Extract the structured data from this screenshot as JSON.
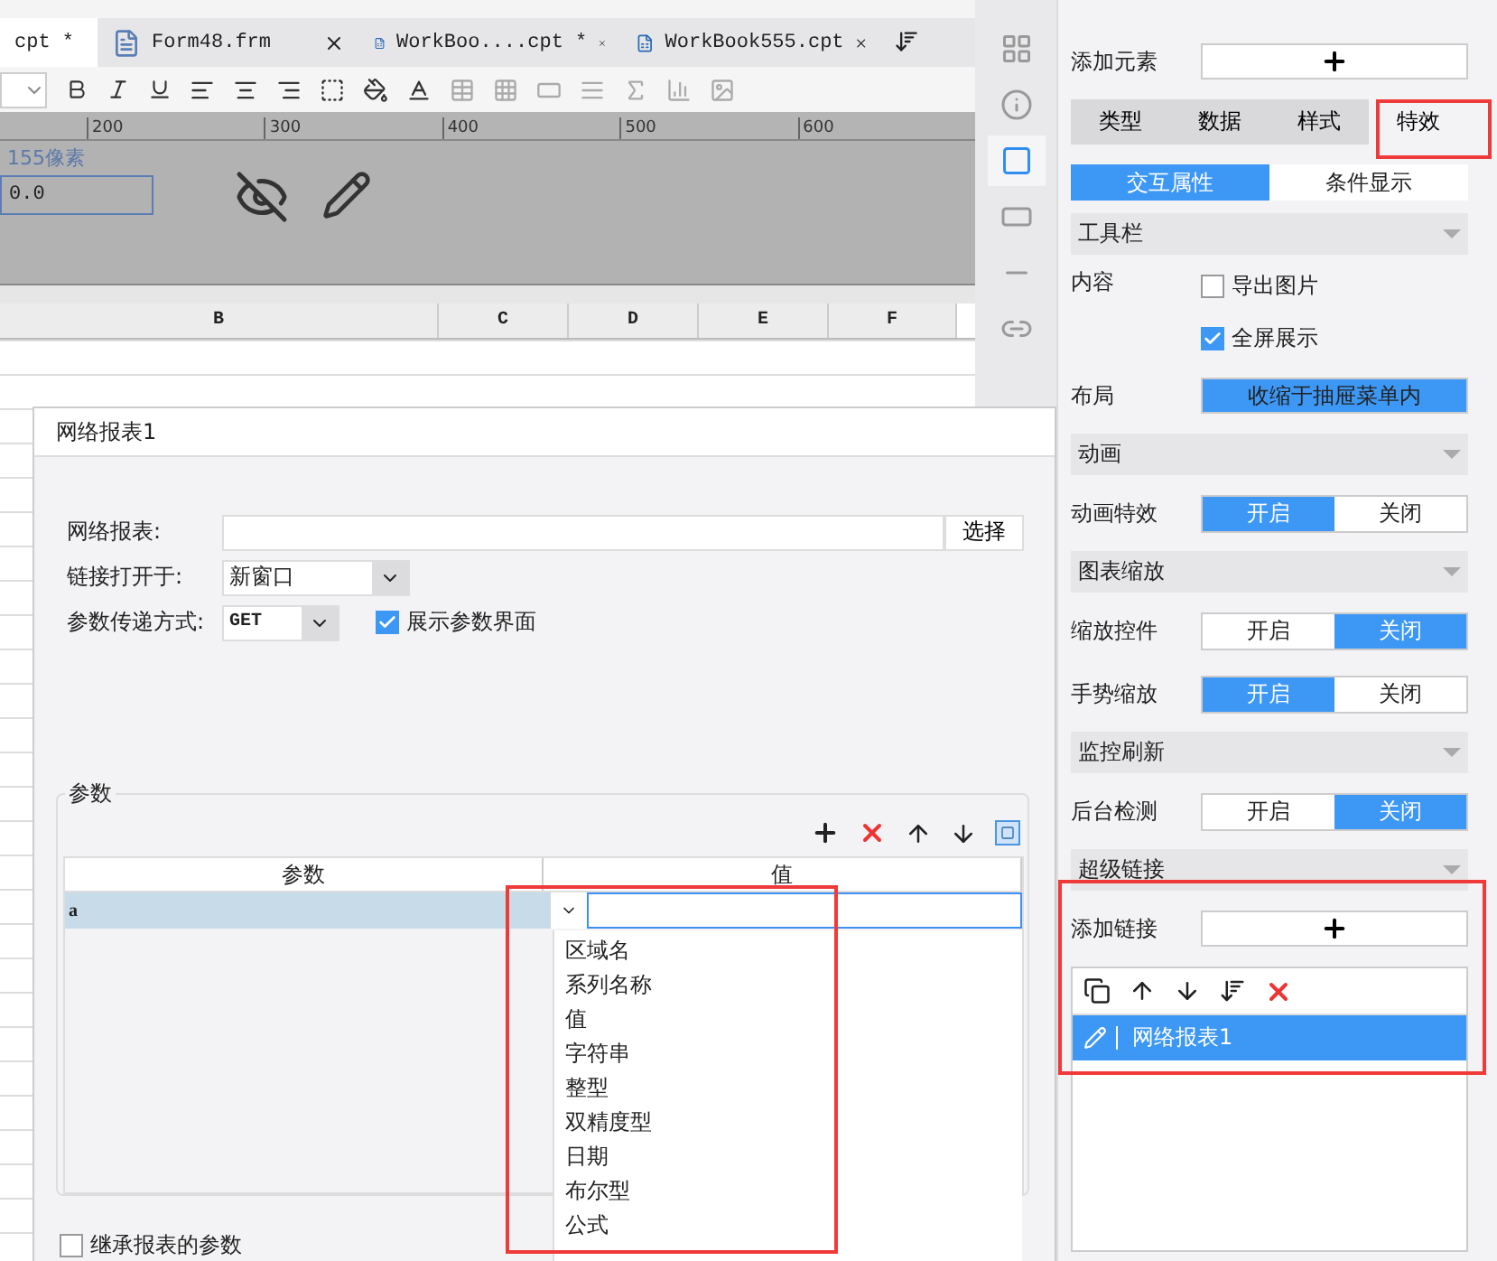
{
  "editor_tabs": [
    {
      "label": "cpt *",
      "selected": true
    },
    {
      "label": "Form48.frm",
      "kind": "form",
      "selected": false
    },
    {
      "label": "WorkBoo....cpt *",
      "kind": "report",
      "selected": false
    },
    {
      "label": "WorkBook555.cpt",
      "kind": "report",
      "selected": false
    }
  ],
  "ruler": [
    "200",
    "300",
    "400",
    "500",
    "600"
  ],
  "canvas": {
    "size_label": "155像素",
    "field_value": "0.0"
  },
  "sheet_columns": [
    "B",
    "C",
    "D",
    "E",
    "F"
  ],
  "right_panel": {
    "add_element_label": "添加元素",
    "tabs": [
      {
        "label": "类型",
        "selected": false
      },
      {
        "label": "数据",
        "selected": false
      },
      {
        "label": "样式",
        "selected": false
      },
      {
        "label": "特效",
        "selected": true
      }
    ],
    "subtabs": [
      {
        "label": "交互属性",
        "selected": true
      },
      {
        "label": "条件显示",
        "selected": false
      }
    ],
    "sections": [
      {
        "title": "工具栏",
        "rows": [
          {
            "kind": "checks",
            "label": "内容",
            "options": [
              {
                "label": "导出图片",
                "checked": false
              },
              {
                "label": "全屏展示",
                "checked": true
              }
            ]
          },
          {
            "kind": "button",
            "label": "布局",
            "value": "收缩于抽屉菜单内"
          }
        ]
      },
      {
        "title": "动画",
        "rows": [
          {
            "kind": "toggle",
            "label": "动画特效",
            "options": [
              {
                "label": "开启",
                "selected": true
              },
              {
                "label": "关闭",
                "selected": false
              }
            ]
          }
        ]
      },
      {
        "title": "图表缩放",
        "rows": [
          {
            "kind": "toggle",
            "label": "缩放控件",
            "options": [
              {
                "label": "开启",
                "selected": false
              },
              {
                "label": "关闭",
                "selected": true
              }
            ]
          },
          {
            "kind": "toggle",
            "label": "手势缩放",
            "options": [
              {
                "label": "开启",
                "selected": true
              },
              {
                "label": "关闭",
                "selected": false
              }
            ]
          }
        ]
      },
      {
        "title": "监控刷新",
        "rows": [
          {
            "kind": "toggle",
            "label": "后台检测",
            "options": [
              {
                "label": "开启",
                "selected": false
              },
              {
                "label": "关闭",
                "selected": true
              }
            ]
          }
        ]
      }
    ],
    "links": {
      "title": "超级链接",
      "add_label": "添加链接",
      "items": [
        {
          "label": "网络报表1",
          "selected": true
        }
      ]
    }
  },
  "dialog": {
    "title": "网络报表1",
    "report_label": "网络报表:",
    "choose_button": "选择",
    "open_label": "链接打开于:",
    "open_value": "新窗口",
    "method_label": "参数传递方式:",
    "method_value": "GET",
    "show_params": {
      "label": "展示参数界面",
      "checked": true
    },
    "params": {
      "title": "参数",
      "columns": [
        "参数",
        "值"
      ],
      "rows": [
        {
          "name": "a",
          "selected": true
        }
      ],
      "type_options": [
        "区域名",
        "系列名称",
        "值",
        "字符串",
        "整型",
        "双精度型",
        "日期",
        "布尔型",
        "公式"
      ]
    },
    "inherit": {
      "label": "继承报表的参数",
      "checked": false
    }
  }
}
